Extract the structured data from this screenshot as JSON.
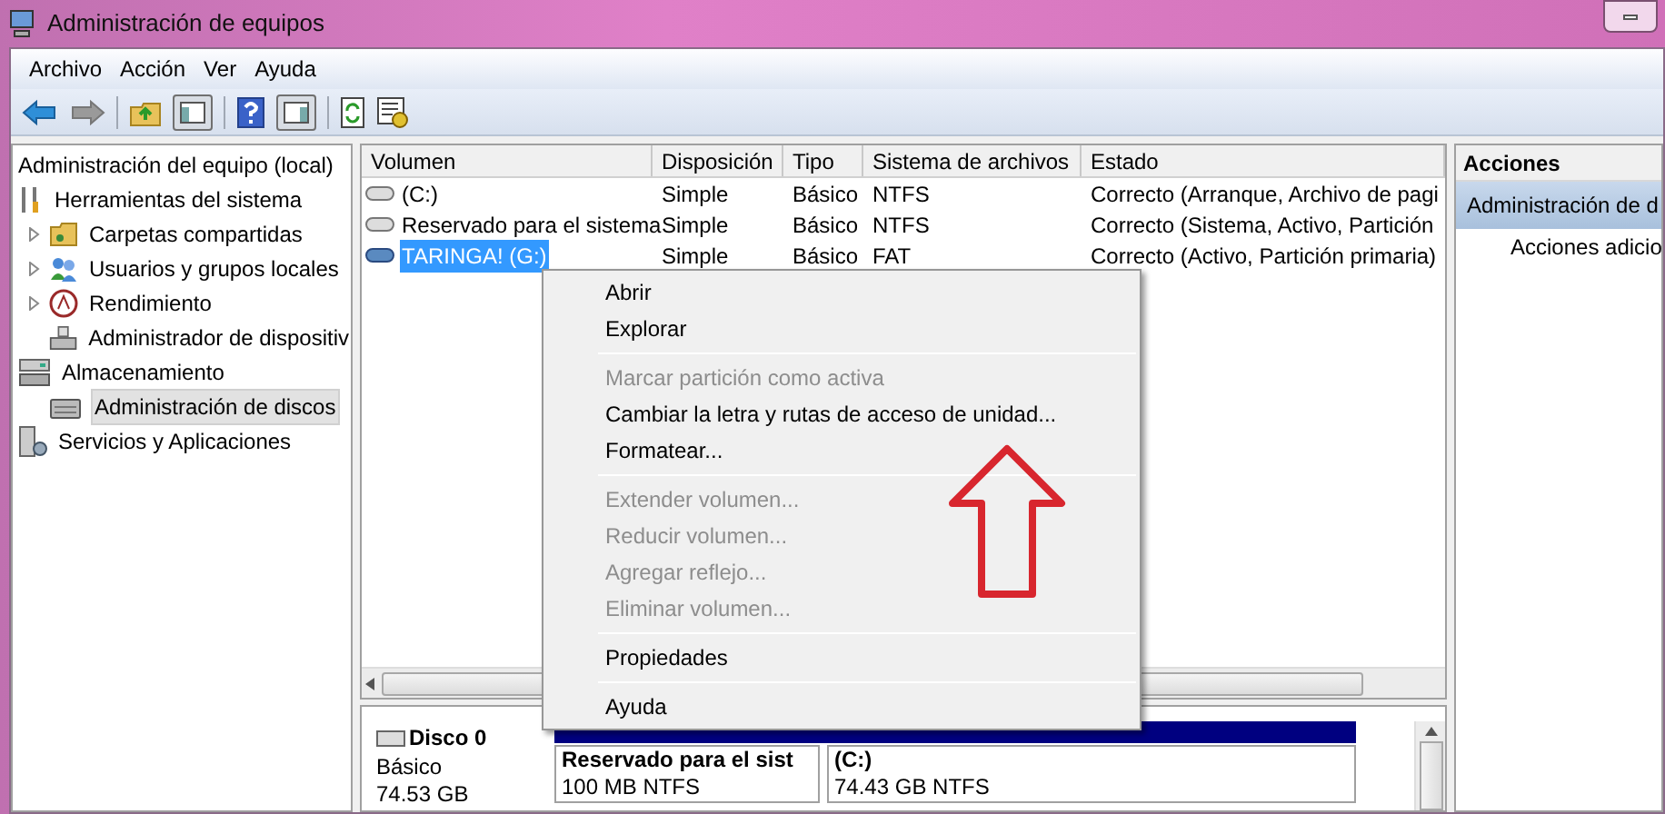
{
  "window": {
    "title": "Administración de equipos"
  },
  "menu": [
    "Archivo",
    "Acción",
    "Ver",
    "Ayuda"
  ],
  "toolbar": [
    {
      "kind": "back"
    },
    {
      "kind": "forward"
    },
    {
      "kind": "sep"
    },
    {
      "kind": "up"
    },
    {
      "kind": "pane",
      "selected": true
    },
    {
      "kind": "sep"
    },
    {
      "kind": "help"
    },
    {
      "kind": "pane2",
      "selected": true
    },
    {
      "kind": "sep"
    },
    {
      "kind": "refresh"
    },
    {
      "kind": "props"
    }
  ],
  "tree": {
    "label": "Administración del equipo (local)",
    "children": [
      {
        "label": "Herramientas del sistema",
        "selected": false,
        "children": [
          {
            "label": "Carpetas compartidas",
            "expandable": true,
            "selected": false
          },
          {
            "label": "Usuarios y grupos locales",
            "expandable": true,
            "selected": false
          },
          {
            "label": "Rendimiento",
            "expandable": true,
            "selected": false
          },
          {
            "label": "Administrador de dispositiv",
            "expandable": false,
            "selected": false
          }
        ]
      },
      {
        "label": "Almacenamiento",
        "selected": false,
        "children": [
          {
            "label": "Administración de discos",
            "expandable": false,
            "selected": true
          }
        ]
      },
      {
        "label": "Servicios y Aplicaciones",
        "selected": false
      }
    ]
  },
  "table": {
    "columns": [
      "Volumen",
      "Disposición",
      "Tipo",
      "Sistema de archivos",
      "Estado"
    ],
    "rows": [
      {
        "cells": [
          "(C:)",
          "Simple",
          "Básico",
          "NTFS",
          "Correcto (Arranque, Archivo de pagi"
        ],
        "selected": false
      },
      {
        "cells": [
          "Reservado para el sistema",
          "Simple",
          "Básico",
          "NTFS",
          "Correcto (Sistema, Activo, Partición"
        ],
        "selected": false
      },
      {
        "cells": [
          "TARINGA! (G:)",
          "Simple",
          "Básico",
          "FAT",
          "Correcto (Activo, Partición primaria)"
        ],
        "selected": true
      }
    ]
  },
  "disk": {
    "name": "Disco 0",
    "type": "Básico",
    "size": "74.53 GB",
    "partitions": [
      {
        "name": "Reservado para el sist",
        "detail": "100 MB NTFS"
      },
      {
        "name": "(C:)",
        "detail": "74.43 GB NTFS"
      }
    ]
  },
  "actions": {
    "title": "Acciones",
    "section": "Administración de d",
    "items": [
      "Acciones adicio"
    ]
  },
  "context_menu": [
    {
      "kind": "item",
      "label": "Abrir",
      "disabled": false
    },
    {
      "kind": "item",
      "label": "Explorar",
      "disabled": false
    },
    {
      "kind": "separator"
    },
    {
      "kind": "item",
      "label": "Marcar partición como activa",
      "disabled": true
    },
    {
      "kind": "item",
      "label": "Cambiar la letra y rutas de acceso de unidad...",
      "disabled": false
    },
    {
      "kind": "item",
      "label": "Formatear...",
      "disabled": false
    },
    {
      "kind": "separator"
    },
    {
      "kind": "item",
      "label": "Extender volumen...",
      "disabled": true
    },
    {
      "kind": "item",
      "label": "Reducir volumen...",
      "disabled": true
    },
    {
      "kind": "item",
      "label": "Agregar reflejo...",
      "disabled": true
    },
    {
      "kind": "item",
      "label": "Eliminar volumen...",
      "disabled": true
    },
    {
      "kind": "separator"
    },
    {
      "kind": "item",
      "label": "Propiedades",
      "disabled": false
    },
    {
      "kind": "separator"
    },
    {
      "kind": "item",
      "label": "Ayuda",
      "disabled": false
    }
  ]
}
